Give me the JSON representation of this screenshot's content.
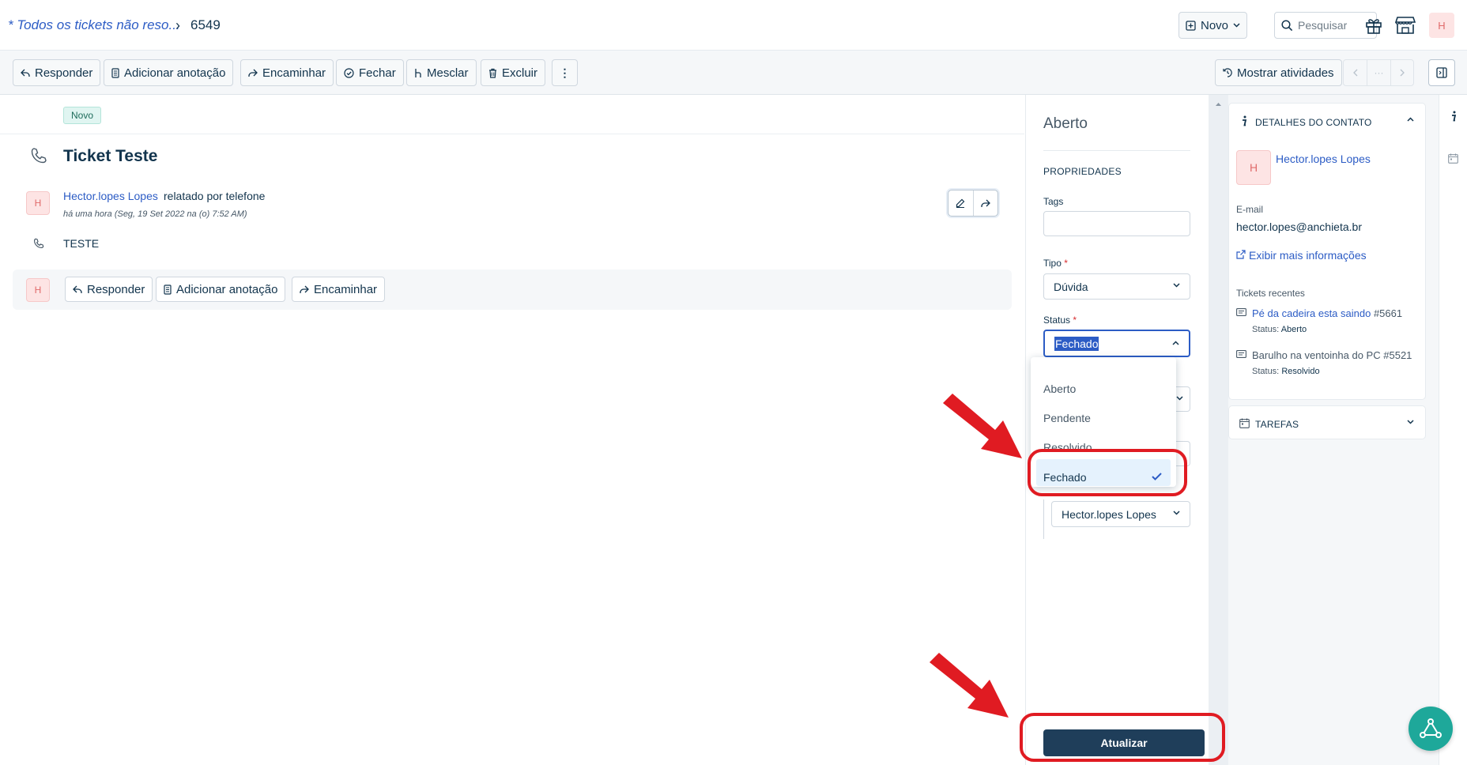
{
  "header": {
    "breadcrumb_link": "* Todos os tickets não reso...",
    "breadcrumb_sep": "›",
    "ticket_id": "6549",
    "new_button": "Novo",
    "search_placeholder": "Pesquisar",
    "avatar_initial": "H"
  },
  "toolbar": {
    "reply": "Responder",
    "add_note": "Adicionar anotação",
    "forward": "Encaminhar",
    "close": "Fechar",
    "merge": "Mesclar",
    "delete": "Excluir",
    "more": "⋮",
    "show_activities": "Mostrar atividades",
    "pager_mid": "···"
  },
  "ticket": {
    "status_badge": "Novo",
    "title": "Ticket Teste",
    "requester_initial": "H",
    "requester_name": "Hector.lopes Lopes",
    "reported_text": "relatado por telefone",
    "timestamp": "há uma hora (Seg, 19 Set 2022 na (o) 7:52 AM)",
    "body": "TESTE"
  },
  "reply_bar": {
    "avatar_initial": "H",
    "reply": "Responder",
    "add_note": "Adicionar anotação",
    "forward": "Encaminhar"
  },
  "properties": {
    "status_heading": "Aberto",
    "section_title": "PROPRIEDADES",
    "tags_label": "Tags",
    "tags_value": "",
    "type_label": "Tipo",
    "type_value": "Dúvida",
    "status_label": "Status",
    "status_value": "Fechado",
    "required_mark": "*",
    "status_options": [
      "Aberto",
      "Pendente",
      "Resolvido",
      "Fechado"
    ],
    "selected_option": "Fechado",
    "agent_value": "Hector.lopes Lopes",
    "update_button": "Atualizar"
  },
  "contact": {
    "section_title": "DETALHES DO CONTATO",
    "avatar_initial": "H",
    "name": "Hector.lopes Lopes",
    "email_label": "E-mail",
    "email": "hector.lopes@anchieta.br",
    "more_info": "Exibir mais informações",
    "recent_label": "Tickets recentes",
    "recent_tickets": [
      {
        "title": "Pé da cadeira esta saindo",
        "id": "#5661",
        "status_label": "Status:",
        "status": "Aberto"
      },
      {
        "title": "Barulho na ventoinha do PC",
        "id": "#5521",
        "status_label": "Status:",
        "status": "Resolvido"
      }
    ],
    "tasks_title": "TAREFAS"
  },
  "colors": {
    "link": "#2c5cc5",
    "text": "#12344d",
    "primary_button": "#1f3e5a",
    "highlight": "#e01b22",
    "fab": "#1ea89a"
  }
}
